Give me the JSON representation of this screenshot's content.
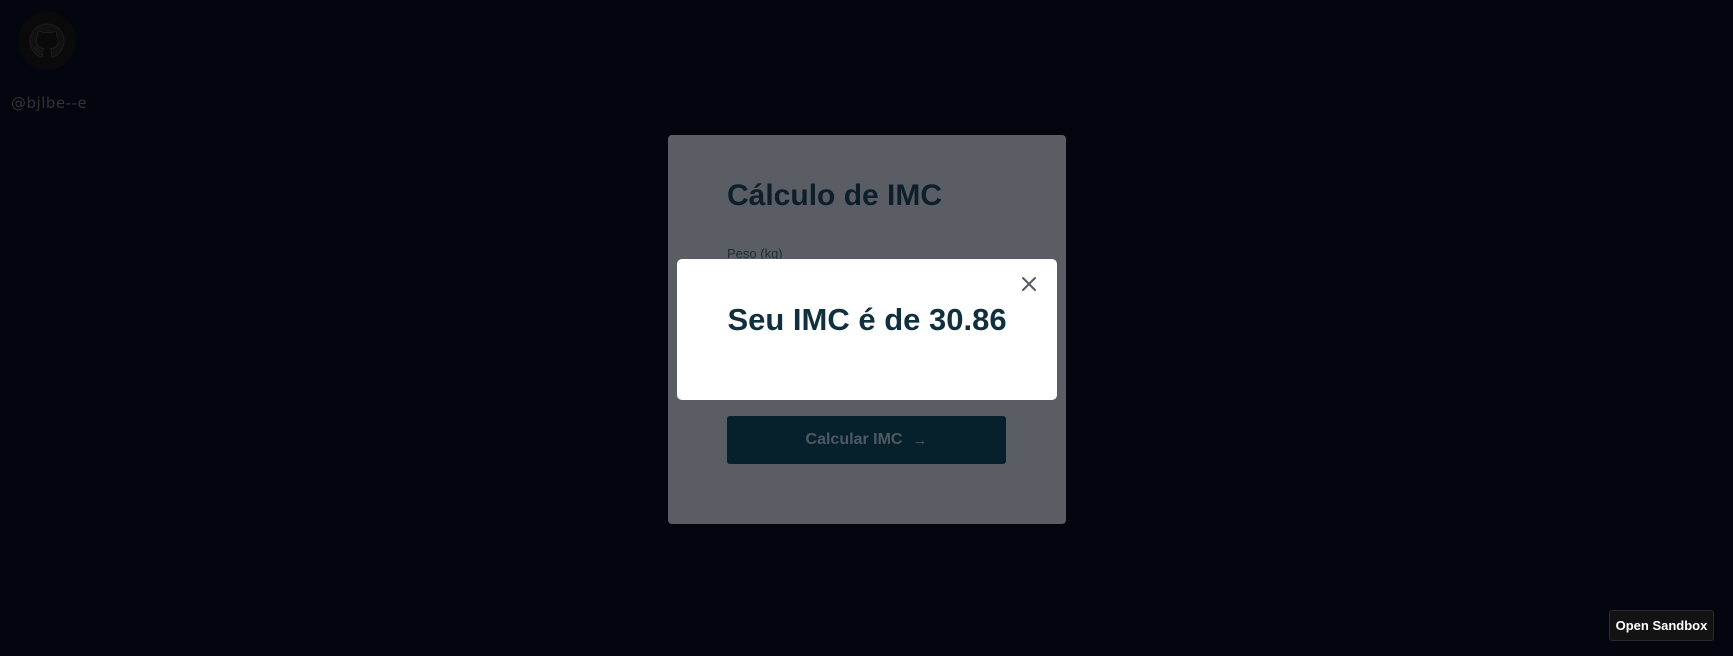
{
  "profile": {
    "username": "@bjlbe--e",
    "logo_icon": "github-icon"
  },
  "form_card": {
    "title": "Cálculo de IMC",
    "weight_label": "Peso (kg)",
    "submit_label": "Calcular IMC",
    "submit_icon": "arrow-right-icon"
  },
  "modal": {
    "result_text": "Seu IMC é de 30.86",
    "close_icon": "close-icon"
  },
  "footer": {
    "open_sandbox_label": "Open Sandbox"
  },
  "colors": {
    "background": "#03060f",
    "overlay_card": "#5a5e64",
    "primary": "#06212c",
    "modal_text": "#11303d"
  }
}
